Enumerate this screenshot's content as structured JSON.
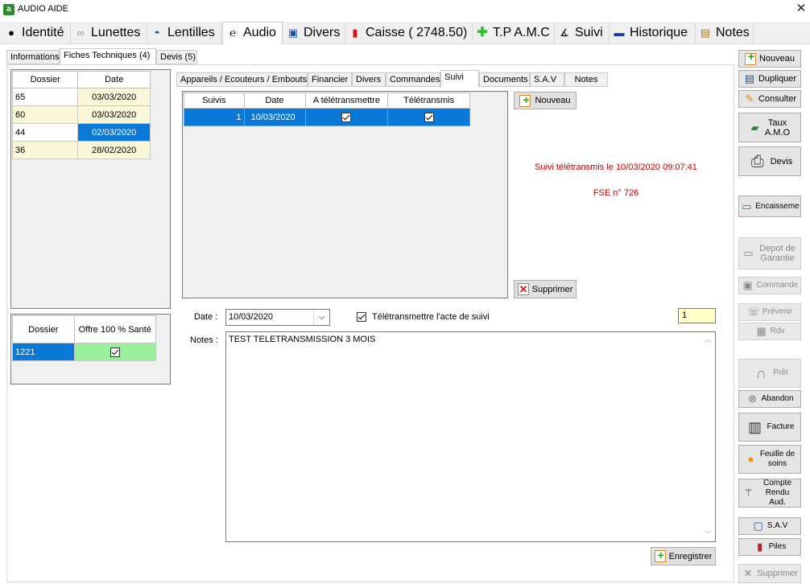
{
  "window": {
    "title": "AUDIO AIDE",
    "close": "✕",
    "app_icon": "a"
  },
  "main_tabs": [
    {
      "label": "Identité",
      "icon": "eye-icon"
    },
    {
      "label": "Lunettes",
      "icon": "glasses-icon"
    },
    {
      "label": "Lentilles",
      "icon": "lens-icon"
    },
    {
      "label": "Audio",
      "icon": "ear-icon",
      "active": true
    },
    {
      "label": "Divers",
      "icon": "folder-icon"
    },
    {
      "label": "Caisse ( 2748.50)",
      "icon": "cash-icon"
    },
    {
      "label": "T.P A.M.C",
      "icon": "cross-icon"
    },
    {
      "label": "Suivi",
      "icon": "compass-icon"
    },
    {
      "label": "Historique",
      "icon": "book-icon"
    },
    {
      "label": "Notes",
      "icon": "notepad-icon"
    }
  ],
  "sub_tabs": [
    {
      "label": "Informations"
    },
    {
      "label": "Fiches Techniques (4)",
      "active": true
    },
    {
      "label": "Devis (5)"
    }
  ],
  "dossier_table": {
    "headers": [
      "Dossier",
      "Date"
    ],
    "rows": [
      {
        "dossier": "65",
        "date": "03/03/2020"
      },
      {
        "dossier": "60",
        "date": "03/03/2020"
      },
      {
        "dossier": "44",
        "date": "02/03/2020",
        "selected": true
      },
      {
        "dossier": "36",
        "date": "28/02/2020"
      }
    ]
  },
  "offre_table": {
    "headers": [
      "Dossier",
      "Offre 100 % Santé"
    ],
    "rows": [
      {
        "dossier": "1221",
        "checked": true
      }
    ]
  },
  "inner_tabs": [
    {
      "label": "Appareils / Ecouteurs / Embouts"
    },
    {
      "label": "Financier"
    },
    {
      "label": "Divers"
    },
    {
      "label": "Commandes"
    },
    {
      "label": "Suivi",
      "active": true
    },
    {
      "label": "Documents"
    },
    {
      "label": "S.A.V"
    },
    {
      "label": "Notes"
    }
  ],
  "suivi_table": {
    "headers": [
      "Suivis",
      "Date",
      "A télétransmettre",
      "Télétransmis"
    ],
    "rows": [
      {
        "suivis": "1",
        "date": "10/03/2020",
        "a_tele": true,
        "tele": true
      }
    ]
  },
  "buttons": {
    "nouveau": "Nouveau",
    "supprimer": "Supprimer",
    "enregistrer": "Enregistrer"
  },
  "messages": {
    "suivi_tele": "Suivi télétransmis le 10/03/2020 09:07:41",
    "fse": "FSE n° 726"
  },
  "form": {
    "date_label": "Date :",
    "date_value": "10/03/2020",
    "tele_label": "Télétransmettre l'acte de suivi",
    "tele_checked": true,
    "counter": "1",
    "notes_label": "Notes :",
    "notes_value": "TEST TELETRANSMISSION 3 MOIS"
  },
  "sidebar": [
    {
      "label": "Nouveau",
      "icon": "new-doc-icon"
    },
    {
      "label": "Dupliquer",
      "icon": "duplicate-icon"
    },
    {
      "label": "Consulter",
      "icon": "consult-icon"
    },
    {
      "label": "Taux A.M.O",
      "icon": "card-icon"
    },
    {
      "label": "Devis",
      "icon": "printer-icon"
    },
    {
      "label": "Encaisseme",
      "icon": "money-icon"
    },
    {
      "label": "Depot de Garantie",
      "icon": "deposit-icon",
      "disabled": true
    },
    {
      "label": "Commande",
      "icon": "order-icon",
      "disabled": true
    },
    {
      "label": "Prévenir",
      "icon": "phone-icon",
      "disabled": true
    },
    {
      "label": "Rdv",
      "icon": "calendar-icon",
      "disabled": true
    },
    {
      "label": "Prêt",
      "icon": "headphones-icon",
      "disabled": true
    },
    {
      "label": "Abandon",
      "icon": "abandon-icon"
    },
    {
      "label": "Facture",
      "icon": "register-icon"
    },
    {
      "label": "Feuille de soins",
      "icon": "sheet-icon"
    },
    {
      "label": "Compte Rendu Aud.",
      "icon": "caduceus-icon"
    },
    {
      "label": "S.A.V",
      "icon": "sav-icon"
    },
    {
      "label": "Piles",
      "icon": "battery-icon"
    },
    {
      "label": "Supprimer",
      "icon": "delete-icon",
      "disabled": true
    }
  ]
}
